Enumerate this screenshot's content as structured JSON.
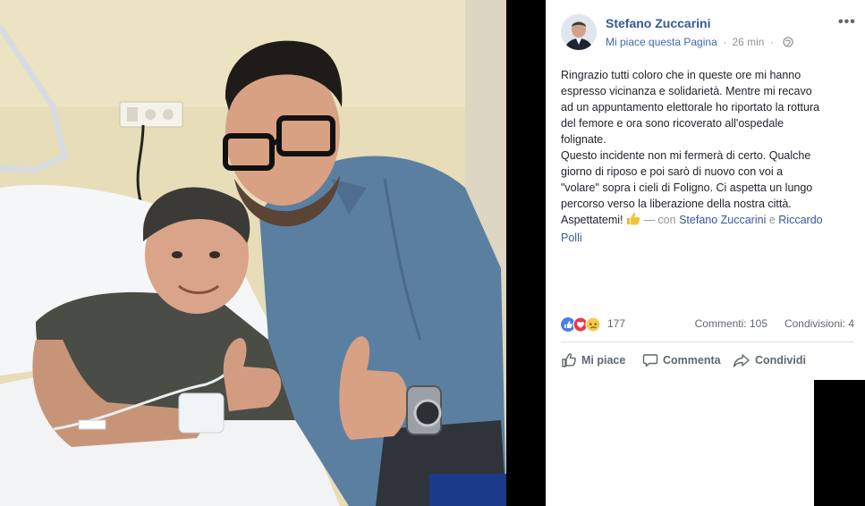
{
  "post": {
    "author_name": "Stefano Zuccarini",
    "like_page_label": "Mi piace questa Pagina",
    "separator": "·",
    "time": "26 min",
    "separator2": "·",
    "more_icon": "more-icon",
    "text_lines": [
      "Ringrazio tutti coloro che in queste ore mi hanno",
      "espresso vicinanza e solidarietà. Mentre mi recavo",
      "ad un appuntamento elettorale ho riportato la rottura",
      "del femore e ora sono ricoverato all'ospedale",
      "folignate.",
      "Questo incidente non mi fermerà di certo. Qualche",
      "giorno di riposo e poi sarò di nuovo con voi a",
      "\"volare\" sopra i cieli di Foligno. Ci aspetta un lungo",
      "percorso verso la liberazione della nostra città."
    ],
    "last_line_text": "Aspettatemi!",
    "with_label": "— con",
    "tagged_1": "Stefano Zuccarini",
    "tag_conjunction": "e",
    "tagged_2_line1": "Riccardo",
    "tagged_2_line2": "Polli"
  },
  "reactions": {
    "icons": [
      "like-icon",
      "love-icon",
      "sad-icon"
    ],
    "count": "177",
    "comments_label": "Commenti: 105",
    "shares_label": "Condivisioni: 4"
  },
  "actions": {
    "like_label": "Mi piace",
    "comment_label": "Commenta",
    "share_label": "Condividi"
  },
  "colors": {
    "link_blue": "#365899",
    "like_blue": "#4267b2",
    "text": "#1d2129",
    "muted": "#90949c"
  }
}
